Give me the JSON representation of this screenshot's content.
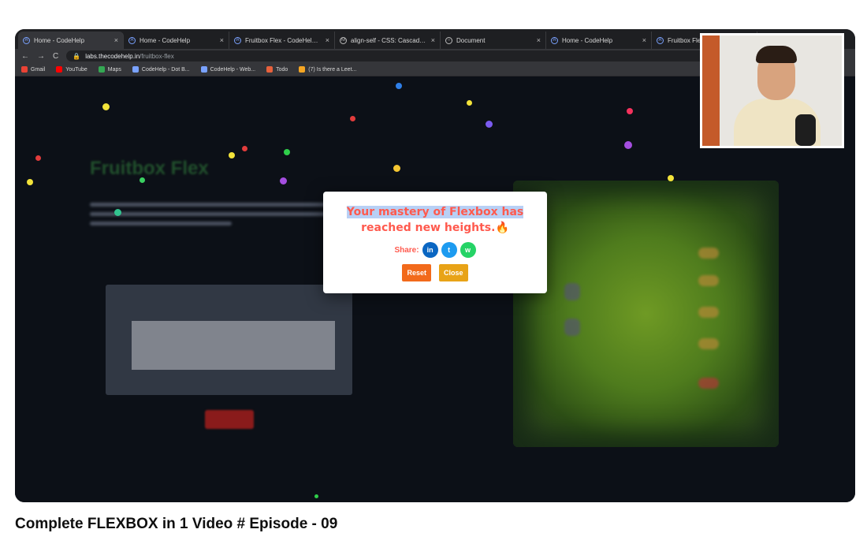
{
  "browser": {
    "tabs": [
      {
        "title": "Home - CodeHelp",
        "active": true
      },
      {
        "title": "Home - CodeHelp",
        "active": false
      },
      {
        "title": "Fruitbox Flex - CodeHelp Labs",
        "active": false
      },
      {
        "title": "align-self - CSS: Cascading St",
        "active": false
      },
      {
        "title": "Document",
        "active": false
      },
      {
        "title": "Home - CodeHelp",
        "active": false
      },
      {
        "title": "Fruitbox Flex -",
        "active": false
      }
    ],
    "url_host": "labs.thecodehelp.in",
    "url_path": "/fruitbox-flex",
    "bookmarks": [
      {
        "label": "Gmail",
        "color": "#ea4335"
      },
      {
        "label": "YouTube",
        "color": "#ff0000"
      },
      {
        "label": "Maps",
        "color": "#34a853"
      },
      {
        "label": "CodeHelp - Dot B...",
        "color": "#7aa2ff"
      },
      {
        "label": "CodeHelp - Web...",
        "color": "#7aa2ff"
      },
      {
        "label": "Todo",
        "color": "#e8613c"
      },
      {
        "label": "(7) Is there a Leet...",
        "color": "#f5a623"
      }
    ]
  },
  "game": {
    "title": "Fruitbox Flex"
  },
  "modal": {
    "message_highlighted": "Your mastery of Flexbox has",
    "message_rest": "reached new heights.🔥",
    "share_label": "Share:",
    "share_icons": [
      {
        "name": "linkedin-icon",
        "glyph": "in",
        "color": "#0a66c2"
      },
      {
        "name": "twitter-icon",
        "glyph": "t",
        "color": "#1d9bf0"
      },
      {
        "name": "whatsapp-icon",
        "glyph": "w",
        "color": "#25d366"
      }
    ],
    "reset_label": "Reset",
    "close_label": "Close",
    "reset_color": "#f26a1b",
    "close_color": "#e8a317",
    "text_color": "#ff5a4e"
  },
  "video_caption": "Complete FLEXBOX in 1 Video # Episode - 09"
}
